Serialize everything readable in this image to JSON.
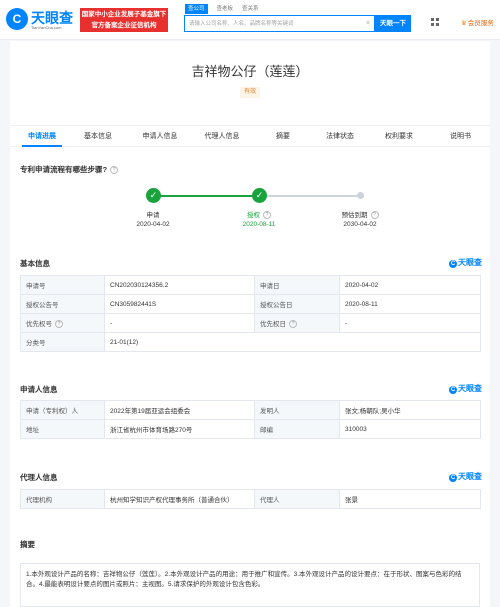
{
  "header": {
    "logo_mark": "C",
    "logo_text": "天眼查",
    "logo_sub": "TianYanCha.com",
    "banner_line1": "国家中小企业发展子基金旗下",
    "banner_line2": "官方备案企业征信机构",
    "search_tabs": [
      "查公司",
      "查老板",
      "查关系"
    ],
    "search_placeholder": "请输入公司名称、人名、品牌名称等关键词",
    "clear_symbol": "×",
    "search_button": "天眼一下",
    "vip_label": "会员服务"
  },
  "patent": {
    "title": "吉祥物公仔（莲莲）",
    "status": "有效"
  },
  "tabs": [
    "申请进展",
    "基本信息",
    "申请人信息",
    "代理人信息",
    "摘要",
    "法律状态",
    "权利要求",
    "说明书"
  ],
  "progress": {
    "title": "专利申请流程有哪些步骤?",
    "steps": [
      {
        "label": "申请",
        "date": "2020-04-02",
        "state": "done"
      },
      {
        "label": "授权",
        "date": "2020-08-11",
        "state": "done"
      },
      {
        "label": "预估到期",
        "date": "2030-04-02",
        "state": "pending"
      }
    ],
    "check_symbol": "✓",
    "help_symbol": "?"
  },
  "brand": {
    "mark": "C",
    "text": "天眼查"
  },
  "basic_info": {
    "title": "基本信息",
    "rows": [
      [
        {
          "k": "申请号"
        },
        {
          "v": "CN202030124356.2"
        },
        {
          "k": "申请日"
        },
        {
          "v": "2020-04-02"
        }
      ],
      [
        {
          "k": "授权公告号"
        },
        {
          "v": "CN305982441S"
        },
        {
          "k": "授权公告日"
        },
        {
          "v": "2020-08-11"
        }
      ],
      [
        {
          "k": "优先权号"
        },
        {
          "v": "-"
        },
        {
          "k": "优先权日"
        },
        {
          "v": "-"
        }
      ],
      [
        {
          "k": "分类号"
        },
        {
          "v": "21-01(12)"
        }
      ]
    ]
  },
  "applicant_info": {
    "title": "申请人信息",
    "rows": [
      [
        {
          "k": "申请（专利权）人"
        },
        {
          "v": "2022年第19届亚运会组委会",
          "link": true
        },
        {
          "k": "发明人"
        },
        {
          "v": "张文;杨朝队;吴小华"
        }
      ],
      [
        {
          "k": "地址"
        },
        {
          "v": "浙江省杭州市体育场路270号"
        },
        {
          "k": "邮编"
        },
        {
          "v": "310003"
        }
      ]
    ]
  },
  "agent_info": {
    "title": "代理人信息",
    "rows": [
      [
        {
          "k": "代理机构"
        },
        {
          "v": "杭州知学知识产权代理事务所（普通合伙）",
          "link": true
        },
        {
          "k": "代理人"
        },
        {
          "v": "张景"
        }
      ]
    ]
  },
  "abstract": {
    "title": "摘要",
    "text": "1.本外观设计产品的名称：吉祥物公仔（莲莲）。2.本外观设计产品的用途：用于推广和宣传。3.本外观设计产品的设计要点：在于形状、图案与色彩的结合。4.最能表明设计要点的图片或照片：主视图。5.请求保护的外观设计包含色彩。"
  }
}
